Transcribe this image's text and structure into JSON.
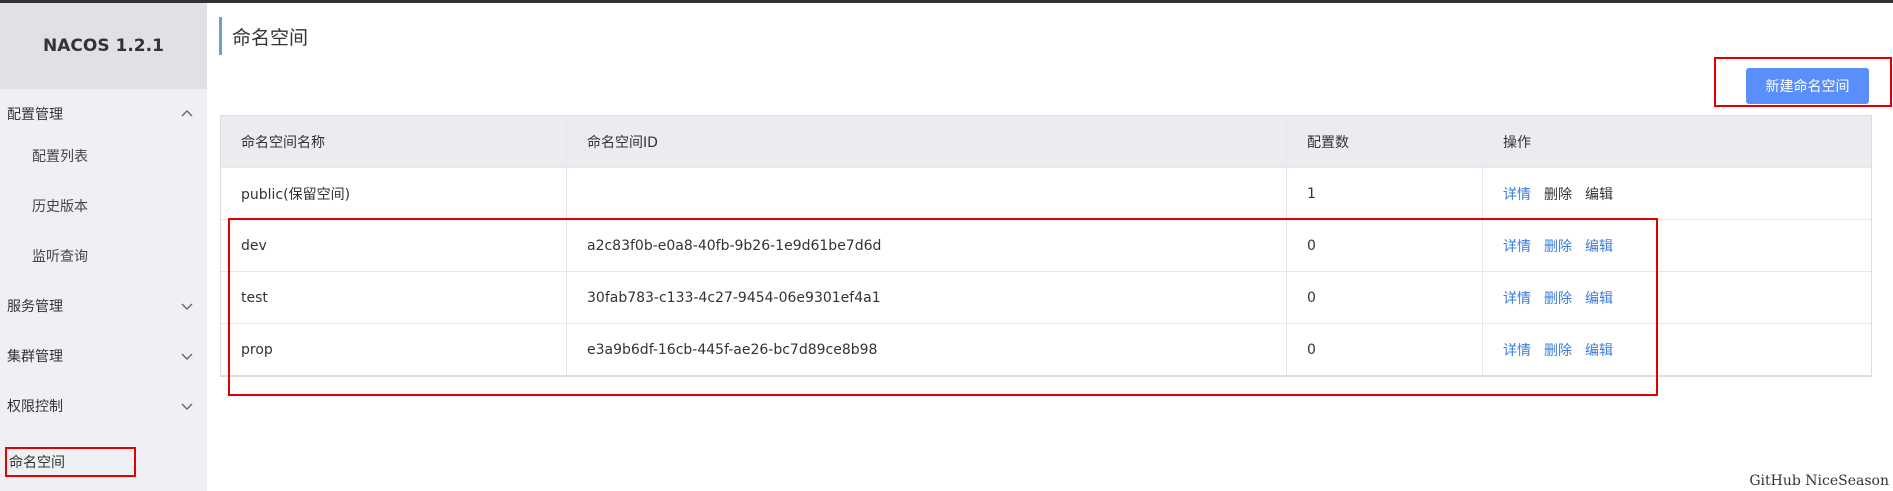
{
  "brand": {
    "title": "NACOS 1.2.1"
  },
  "sidebar": {
    "items": [
      {
        "label": "配置管理",
        "type": "group",
        "chevron": "up"
      },
      {
        "label": "配置列表",
        "type": "sub"
      },
      {
        "label": "历史版本",
        "type": "sub"
      },
      {
        "label": "监听查询",
        "type": "sub"
      },
      {
        "label": "服务管理",
        "type": "group",
        "chevron": "down"
      },
      {
        "label": "集群管理",
        "type": "group",
        "chevron": "down"
      },
      {
        "label": "权限控制",
        "type": "group",
        "chevron": "down"
      },
      {
        "label": "命名空间",
        "type": "group",
        "active": true
      }
    ]
  },
  "page": {
    "title": "命名空间",
    "create_button": "新建命名空间"
  },
  "table": {
    "columns": [
      "命名空间名称",
      "命名空间ID",
      "配置数",
      "操作"
    ],
    "rows": [
      {
        "name": "public(保留空间)",
        "id": "",
        "count": "1"
      },
      {
        "name": "dev",
        "id": "a2c83f0b-e0a8-40fb-9b26-1e9d61be7d6d",
        "count": "0"
      },
      {
        "name": "test",
        "id": "30fab783-c133-4c27-9454-06e9301ef4a1",
        "count": "0"
      },
      {
        "name": "prop",
        "id": "e3a9b6df-16cb-445f-ae26-bc7d89ce8b98",
        "count": "0"
      }
    ],
    "actions": {
      "detail": "详情",
      "delete": "删除",
      "edit": "编辑"
    }
  },
  "watermark": "GitHub NiceSeason",
  "colors": {
    "primary": "#5a8ffb",
    "link": "#3a7cde",
    "highlight": "#e40000",
    "sidebar_bg": "#eef0f3"
  },
  "icons": {
    "chevron_up": "chevron-up-icon",
    "chevron_down": "chevron-down-icon"
  }
}
